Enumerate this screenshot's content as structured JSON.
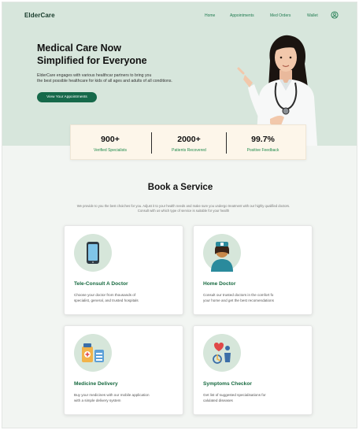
{
  "nav": {
    "brand": "ElderCare",
    "links": [
      "Home",
      "Appointments",
      "Med Orders",
      "Wallet"
    ],
    "user_icon": "user-circle-icon"
  },
  "hero": {
    "title_line1": "Medical Care Now",
    "title_line2": "Simplified for Everyone",
    "description_line1": "ElderCare engages with various healthcar partners to bring you",
    "description_line2": "the best possible healthcare for kids of all ages and adults of all conditions.",
    "cta_label": "View Your Appointments"
  },
  "stats": [
    {
      "value": "900+",
      "label": "Verified Specialists"
    },
    {
      "value": "2000+",
      "label": "Patients Recovered"
    },
    {
      "value": "99.7%",
      "label": "Positive Feedback"
    }
  ],
  "services": {
    "title": "Book a Service",
    "description_line1": "We provide to you the best choiches for you. Adjust it to your health needs and make sure you undergo treatment with our highly qualified doctors.",
    "description_line2": "Consult with us which type of service is suitable for your health",
    "cards": [
      {
        "title": "Tele-Consult A Doctor",
        "desc_line1": "Choose your doctor from thousands of",
        "desc_line2": "specialist, general, and trusted hospitals",
        "icon": "phone-icon"
      },
      {
        "title": "Home Doctor",
        "desc_line1": "Consult our trusted doctors in the comfort fo",
        "desc_line2": "your home and get the best recomendations",
        "icon": "nurse-icon"
      },
      {
        "title": "Medicine Delivery",
        "desc_line1": "Buy your medicines with our mobile application",
        "desc_line2": "with a simple delivery system",
        "icon": "medicine-icon"
      },
      {
        "title": "Symptoms Checkor",
        "desc_line1": "Get list of suggested specialisations for",
        "desc_line2": "calulated diseases",
        "icon": "symptoms-icon"
      }
    ]
  },
  "colors": {
    "hero_bg": "#d7e6dc",
    "accent": "#16694a",
    "stats_bg": "#fdf6ea",
    "stat_label": "#1f8a4c"
  }
}
